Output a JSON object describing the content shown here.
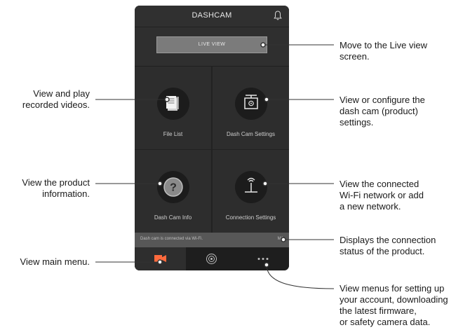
{
  "phone": {
    "title": "DASHCAM",
    "live_view_label": "LIVE VIEW",
    "menu": [
      {
        "label": "File List",
        "icon": "file-list-icon"
      },
      {
        "label": "Dash Cam Settings",
        "icon": "dashcam-settings-icon"
      },
      {
        "label": "Dash Cam Info",
        "icon": "question-icon"
      },
      {
        "label": "Connection Settings",
        "icon": "router-icon"
      }
    ],
    "status_text": "Dash cam is connected via Wi-Fi.",
    "status_model": "M1",
    "nav": [
      {
        "icon": "camera-icon"
      },
      {
        "icon": "wifi-broadcast-icon"
      },
      {
        "icon": "more-dots-icon"
      }
    ]
  },
  "callouts": {
    "live_view": [
      "Move to the Live view",
      "screen."
    ],
    "file_list": [
      "View and play",
      "recorded videos."
    ],
    "settings": [
      "View or configure the",
      "dash cam (product)",
      "settings."
    ],
    "info": [
      "View the product",
      "information."
    ],
    "connection": [
      "View the connected",
      "Wi-Fi network or add",
      "a new network."
    ],
    "status": [
      "Displays the connection",
      "status of the product."
    ],
    "main_menu": [
      "View main menu."
    ],
    "more": [
      "View menus for setting up",
      "your account, downloading",
      "the latest firmware,",
      "or safety camera data."
    ]
  },
  "colors": {
    "phone_bg": "#2b2b2b",
    "live_button": "#7b7b7b",
    "status_bar": "#575757",
    "nav_bg": "#1e1e1e"
  }
}
